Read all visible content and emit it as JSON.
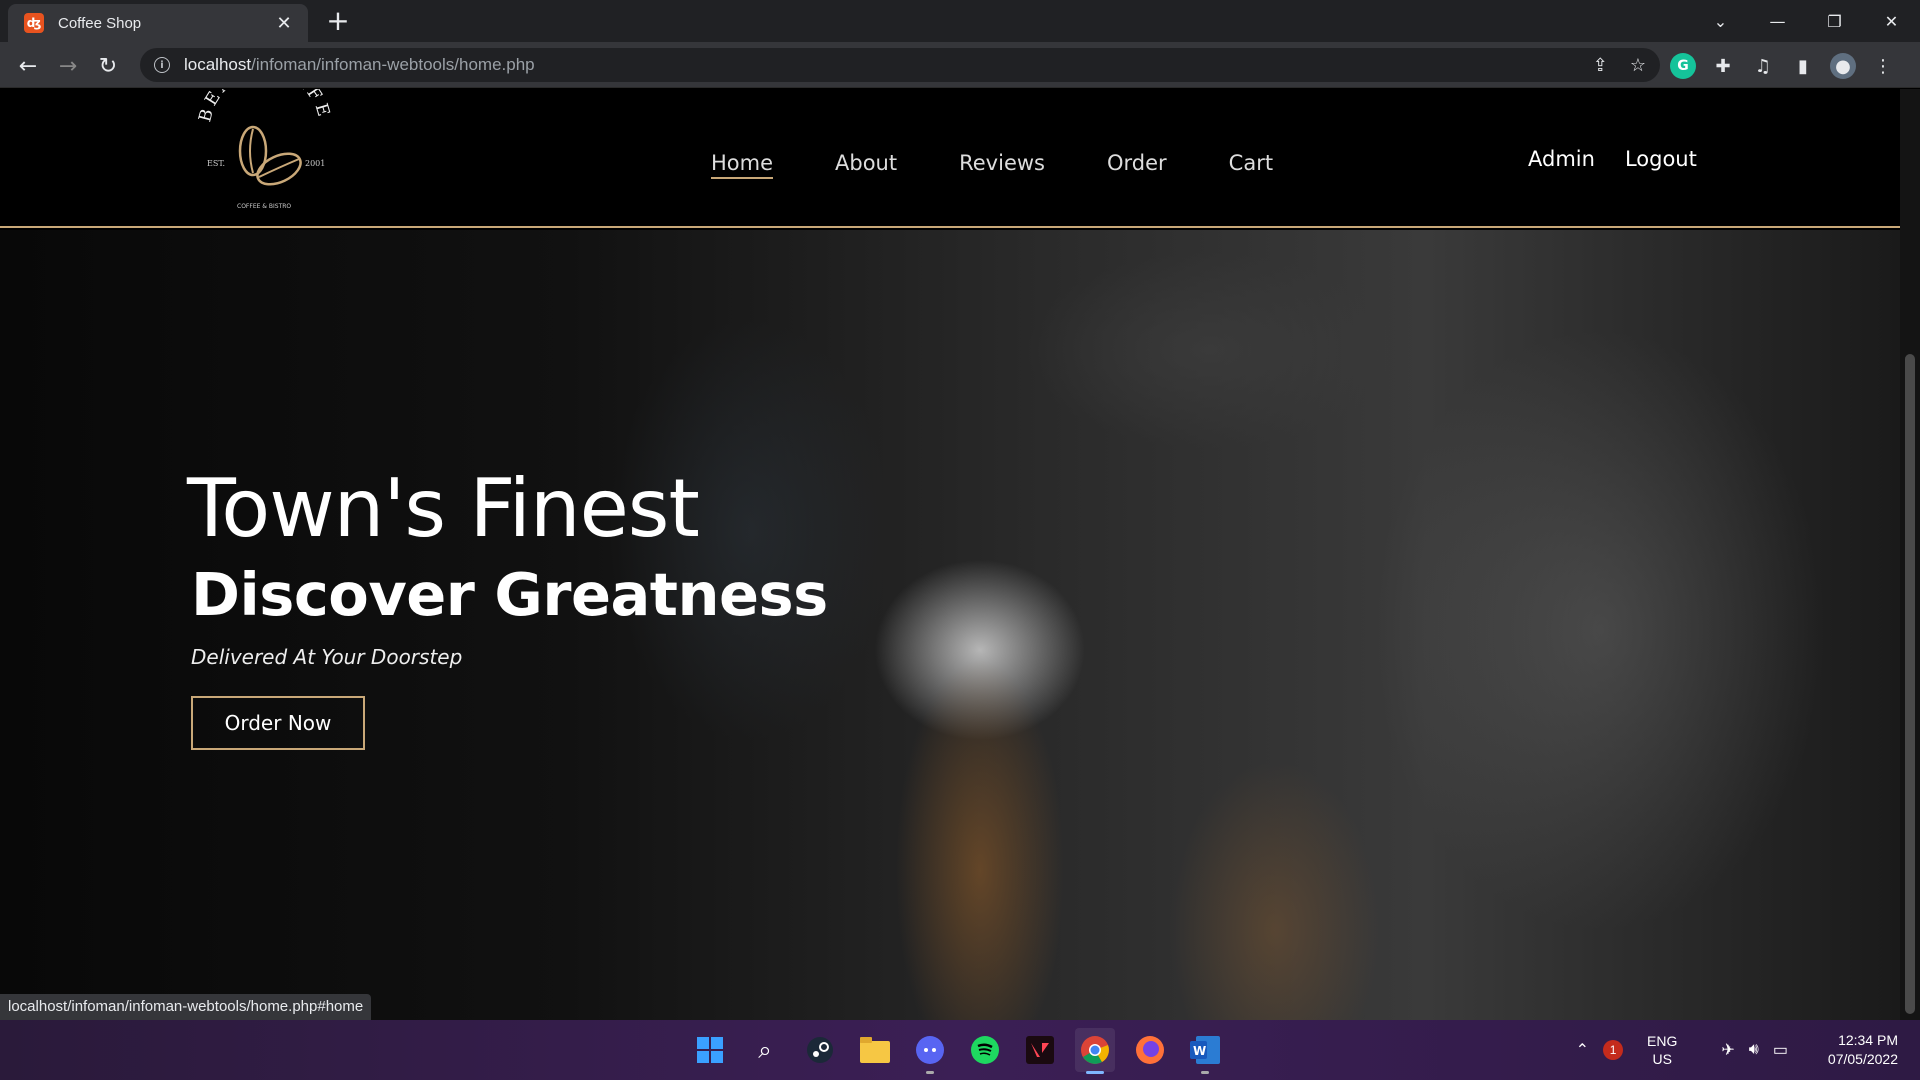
{
  "browser": {
    "tab_title": "Coffee Shop",
    "tab_close": "✕",
    "new_tab": "+",
    "url_host": "localhost",
    "url_path": "/infoman/infoman-webtools/home.php",
    "status_url": "localhost/infoman/infoman-webtools/home.php#home"
  },
  "site": {
    "logo_text_top": "BEANS CAFE",
    "logo_est": "EST.",
    "logo_year": "2001",
    "logo_bottom": "COFFEE & BISTRO",
    "nav": {
      "home": "Home",
      "about": "About",
      "reviews": "Reviews",
      "order": "Order",
      "cart": "Cart"
    },
    "admin": "Admin",
    "logout": "Logout"
  },
  "hero": {
    "title": "Town's Finest",
    "subtitle": "Discover Greatness",
    "tagline": "Delivered At Your Doorstep",
    "cta": "Order Now"
  },
  "taskbar": {
    "lang_top": "ENG",
    "lang_bottom": "US",
    "time": "12:34 PM",
    "date": "07/05/2022",
    "notification_count": "1"
  },
  "colors": {
    "accent": "#c9a878",
    "taskbar": "#3b1f55"
  }
}
